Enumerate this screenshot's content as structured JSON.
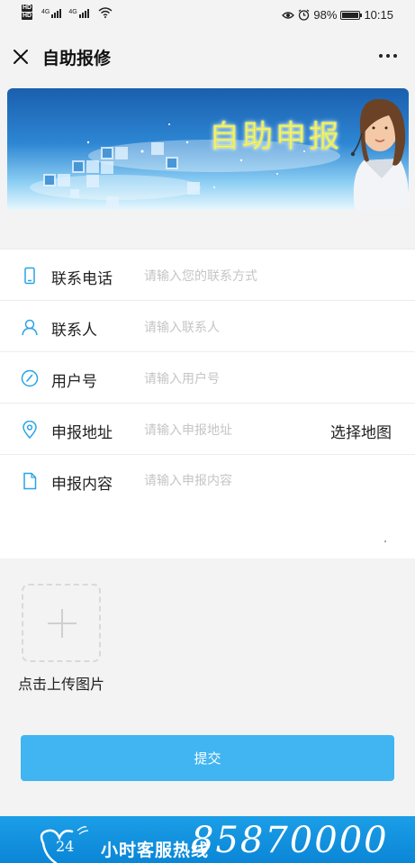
{
  "status_bar": {
    "hd_labels": [
      "HD",
      "HD"
    ],
    "network_1": "4G",
    "network_2": "4G",
    "battery_percent": "98%",
    "battery_level": 0.98,
    "time": "10:15",
    "icons": [
      "eye-icon",
      "alarm-icon",
      "wifi-icon",
      "battery-icon"
    ]
  },
  "header": {
    "title": "自助报修",
    "close_icon": "close-icon",
    "more_icon": "more-icon"
  },
  "banner": {
    "title": "自助申报"
  },
  "form": {
    "rows": [
      {
        "label": "联系电话",
        "placeholder": "请输入您的联系方式",
        "icon": "phone-icon"
      },
      {
        "label": "联系人",
        "placeholder": "请输入联系人",
        "icon": "person-icon"
      },
      {
        "label": "用户号",
        "placeholder": "请输入用户号",
        "icon": "compass-icon"
      },
      {
        "label": "申报地址",
        "placeholder": "请输入申报地址",
        "icon": "location-pin-icon",
        "action": "选择地图"
      },
      {
        "label": "申报内容",
        "placeholder": "请输入申报内容",
        "icon": "document-icon"
      }
    ]
  },
  "upload": {
    "label": "点击上传图片",
    "icon": "plus-icon"
  },
  "submit": {
    "label": "提交"
  },
  "hotline": {
    "hours_text": "24",
    "service_text": "小时客服热线",
    "number": "85870000"
  },
  "colors": {
    "accent": "#40b5f2",
    "icon_blue": "#29a3e6",
    "hotline_bg": "#0a86d6",
    "banner_title": "#f4f07c"
  }
}
